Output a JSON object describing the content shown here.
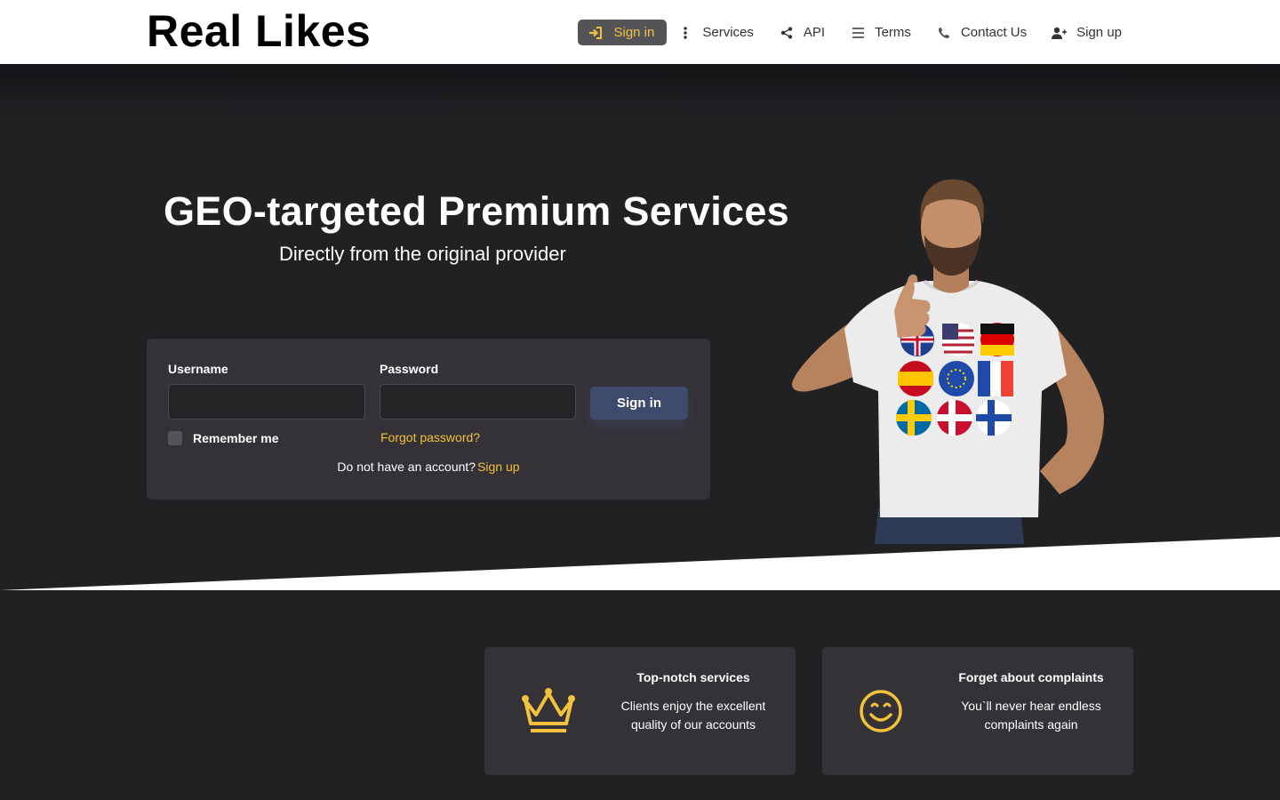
{
  "header": {
    "brand": "Real Likes",
    "nav": {
      "signin": "Sign in",
      "services": "Services",
      "api": "API",
      "terms": "Terms",
      "contact": "Contact Us",
      "signup": "Sign up"
    }
  },
  "hero": {
    "title": "GEO-targeted Premium Services",
    "subtitle": "Directly from the original provider"
  },
  "login": {
    "username_label": "Username",
    "username_value": "",
    "password_label": "Password",
    "password_value": "",
    "signin_button": "Sign in",
    "remember_label": "Remember me",
    "forgot_link": "Forgot password?",
    "no_account_text": "Do not have an account?",
    "signup_link": "Sign up"
  },
  "features": [
    {
      "title": "Top-notch services",
      "desc": "Clients enjoy the excellent quality of our accounts",
      "icon": "crown-icon"
    },
    {
      "title": "Forget about complaints",
      "desc": "You`ll never hear endless complaints again",
      "icon": "smile-icon"
    }
  ],
  "colors": {
    "accent": "#f2c23c",
    "dark_bg": "#212023",
    "card_bg": "#343237",
    "button_blue": "#3e4a6b"
  }
}
